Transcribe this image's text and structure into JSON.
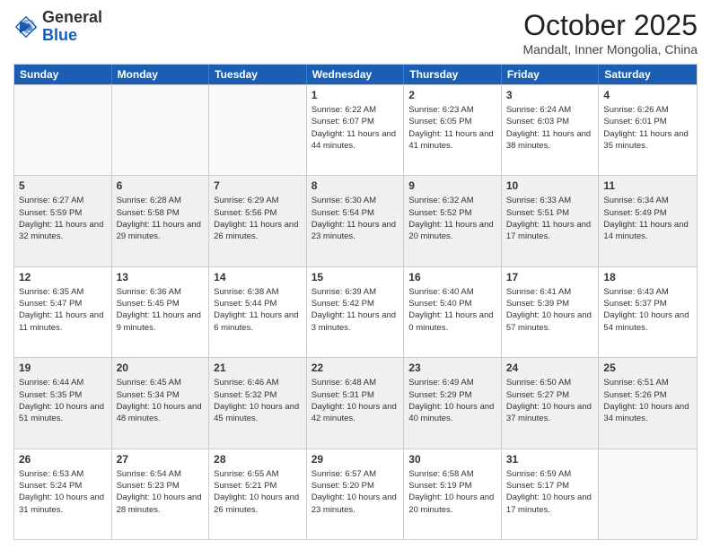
{
  "logo": {
    "general": "General",
    "blue": "Blue"
  },
  "header": {
    "month": "October 2025",
    "location": "Mandalt, Inner Mongolia, China"
  },
  "days_of_week": [
    "Sunday",
    "Monday",
    "Tuesday",
    "Wednesday",
    "Thursday",
    "Friday",
    "Saturday"
  ],
  "weeks": [
    [
      {
        "day": "",
        "empty": true
      },
      {
        "day": "",
        "empty": true
      },
      {
        "day": "",
        "empty": true
      },
      {
        "day": "1",
        "sunrise": "6:22 AM",
        "sunset": "6:07 PM",
        "daylight": "11 hours and 44 minutes."
      },
      {
        "day": "2",
        "sunrise": "6:23 AM",
        "sunset": "6:05 PM",
        "daylight": "11 hours and 41 minutes."
      },
      {
        "day": "3",
        "sunrise": "6:24 AM",
        "sunset": "6:03 PM",
        "daylight": "11 hours and 38 minutes."
      },
      {
        "day": "4",
        "sunrise": "6:26 AM",
        "sunset": "6:01 PM",
        "daylight": "11 hours and 35 minutes."
      }
    ],
    [
      {
        "day": "5",
        "sunrise": "6:27 AM",
        "sunset": "5:59 PM",
        "daylight": "11 hours and 32 minutes."
      },
      {
        "day": "6",
        "sunrise": "6:28 AM",
        "sunset": "5:58 PM",
        "daylight": "11 hours and 29 minutes."
      },
      {
        "day": "7",
        "sunrise": "6:29 AM",
        "sunset": "5:56 PM",
        "daylight": "11 hours and 26 minutes."
      },
      {
        "day": "8",
        "sunrise": "6:30 AM",
        "sunset": "5:54 PM",
        "daylight": "11 hours and 23 minutes."
      },
      {
        "day": "9",
        "sunrise": "6:32 AM",
        "sunset": "5:52 PM",
        "daylight": "11 hours and 20 minutes."
      },
      {
        "day": "10",
        "sunrise": "6:33 AM",
        "sunset": "5:51 PM",
        "daylight": "11 hours and 17 minutes."
      },
      {
        "day": "11",
        "sunrise": "6:34 AM",
        "sunset": "5:49 PM",
        "daylight": "11 hours and 14 minutes."
      }
    ],
    [
      {
        "day": "12",
        "sunrise": "6:35 AM",
        "sunset": "5:47 PM",
        "daylight": "11 hours and 11 minutes."
      },
      {
        "day": "13",
        "sunrise": "6:36 AM",
        "sunset": "5:45 PM",
        "daylight": "11 hours and 9 minutes."
      },
      {
        "day": "14",
        "sunrise": "6:38 AM",
        "sunset": "5:44 PM",
        "daylight": "11 hours and 6 minutes."
      },
      {
        "day": "15",
        "sunrise": "6:39 AM",
        "sunset": "5:42 PM",
        "daylight": "11 hours and 3 minutes."
      },
      {
        "day": "16",
        "sunrise": "6:40 AM",
        "sunset": "5:40 PM",
        "daylight": "11 hours and 0 minutes."
      },
      {
        "day": "17",
        "sunrise": "6:41 AM",
        "sunset": "5:39 PM",
        "daylight": "10 hours and 57 minutes."
      },
      {
        "day": "18",
        "sunrise": "6:43 AM",
        "sunset": "5:37 PM",
        "daylight": "10 hours and 54 minutes."
      }
    ],
    [
      {
        "day": "19",
        "sunrise": "6:44 AM",
        "sunset": "5:35 PM",
        "daylight": "10 hours and 51 minutes."
      },
      {
        "day": "20",
        "sunrise": "6:45 AM",
        "sunset": "5:34 PM",
        "daylight": "10 hours and 48 minutes."
      },
      {
        "day": "21",
        "sunrise": "6:46 AM",
        "sunset": "5:32 PM",
        "daylight": "10 hours and 45 minutes."
      },
      {
        "day": "22",
        "sunrise": "6:48 AM",
        "sunset": "5:31 PM",
        "daylight": "10 hours and 42 minutes."
      },
      {
        "day": "23",
        "sunrise": "6:49 AM",
        "sunset": "5:29 PM",
        "daylight": "10 hours and 40 minutes."
      },
      {
        "day": "24",
        "sunrise": "6:50 AM",
        "sunset": "5:27 PM",
        "daylight": "10 hours and 37 minutes."
      },
      {
        "day": "25",
        "sunrise": "6:51 AM",
        "sunset": "5:26 PM",
        "daylight": "10 hours and 34 minutes."
      }
    ],
    [
      {
        "day": "26",
        "sunrise": "6:53 AM",
        "sunset": "5:24 PM",
        "daylight": "10 hours and 31 minutes."
      },
      {
        "day": "27",
        "sunrise": "6:54 AM",
        "sunset": "5:23 PM",
        "daylight": "10 hours and 28 minutes."
      },
      {
        "day": "28",
        "sunrise": "6:55 AM",
        "sunset": "5:21 PM",
        "daylight": "10 hours and 26 minutes."
      },
      {
        "day": "29",
        "sunrise": "6:57 AM",
        "sunset": "5:20 PM",
        "daylight": "10 hours and 23 minutes."
      },
      {
        "day": "30",
        "sunrise": "6:58 AM",
        "sunset": "5:19 PM",
        "daylight": "10 hours and 20 minutes."
      },
      {
        "day": "31",
        "sunrise": "6:59 AM",
        "sunset": "5:17 PM",
        "daylight": "10 hours and 17 minutes."
      },
      {
        "day": "",
        "empty": true
      }
    ]
  ]
}
